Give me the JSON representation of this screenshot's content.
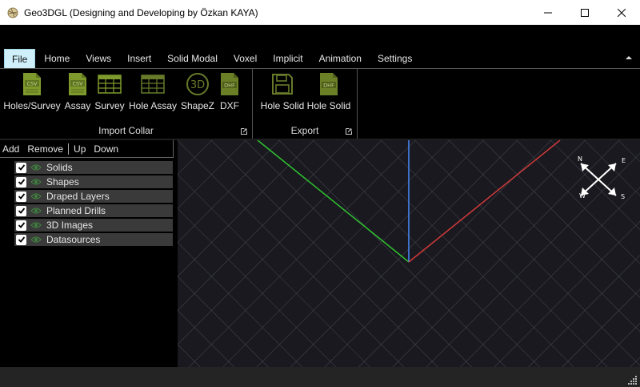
{
  "window": {
    "title": "Geo3DGL (Designing and Developing by Özkan KAYA)",
    "app_icon": "globe-app-icon",
    "controls": [
      "minimize-icon",
      "maximize-icon",
      "close-icon"
    ]
  },
  "ribbon_tabs": [
    {
      "label": "File",
      "active": true
    },
    {
      "label": "Home"
    },
    {
      "label": "Views"
    },
    {
      "label": "Insert"
    },
    {
      "label": "Solid Modal"
    },
    {
      "label": "Voxel"
    },
    {
      "label": "Implicit"
    },
    {
      "label": "Animation"
    },
    {
      "label": "Settings"
    }
  ],
  "ribbon_groups": {
    "import_collar": {
      "label": "Import Collar",
      "buttons": [
        {
          "label": "Holes/Survey",
          "icon": "csv-file-icon"
        },
        {
          "label": "Assay",
          "icon": "csv-file-icon"
        },
        {
          "label": "Survey",
          "icon": "table-icon"
        },
        {
          "label": "Hole Assay",
          "icon": "table-icon"
        },
        {
          "label": "ShapeZ",
          "icon": "3d-circle-icon"
        },
        {
          "label": "DXF",
          "icon": "dxf-file-icon"
        }
      ]
    },
    "export": {
      "label": "Export",
      "buttons": [
        {
          "label": "Hole Solid",
          "icon": "save-disk-icon"
        },
        {
          "label": "Hole Solid",
          "icon": "dxf-file-icon"
        }
      ]
    }
  },
  "layer_toolbar": {
    "add": "Add",
    "remove": "Remove",
    "up": "Up",
    "down": "Down"
  },
  "layers": [
    {
      "label": "Solids",
      "checked": true
    },
    {
      "label": "Shapes",
      "checked": true
    },
    {
      "label": "Draped Layers",
      "checked": true
    },
    {
      "label": "Planned Drills",
      "checked": true
    },
    {
      "label": "3D Images",
      "checked": true
    },
    {
      "label": "Datasources",
      "checked": true
    }
  ],
  "compass": {
    "n": "N",
    "e": "E",
    "s": "S",
    "w": "W"
  },
  "colors": {
    "icon_green": "#7f9a2c",
    "axis_green": "#2fc22f",
    "axis_blue": "#4a8cff",
    "axis_red": "#d23a3a",
    "active_tab": "#cfeffb",
    "grid": "#5a5a66"
  }
}
